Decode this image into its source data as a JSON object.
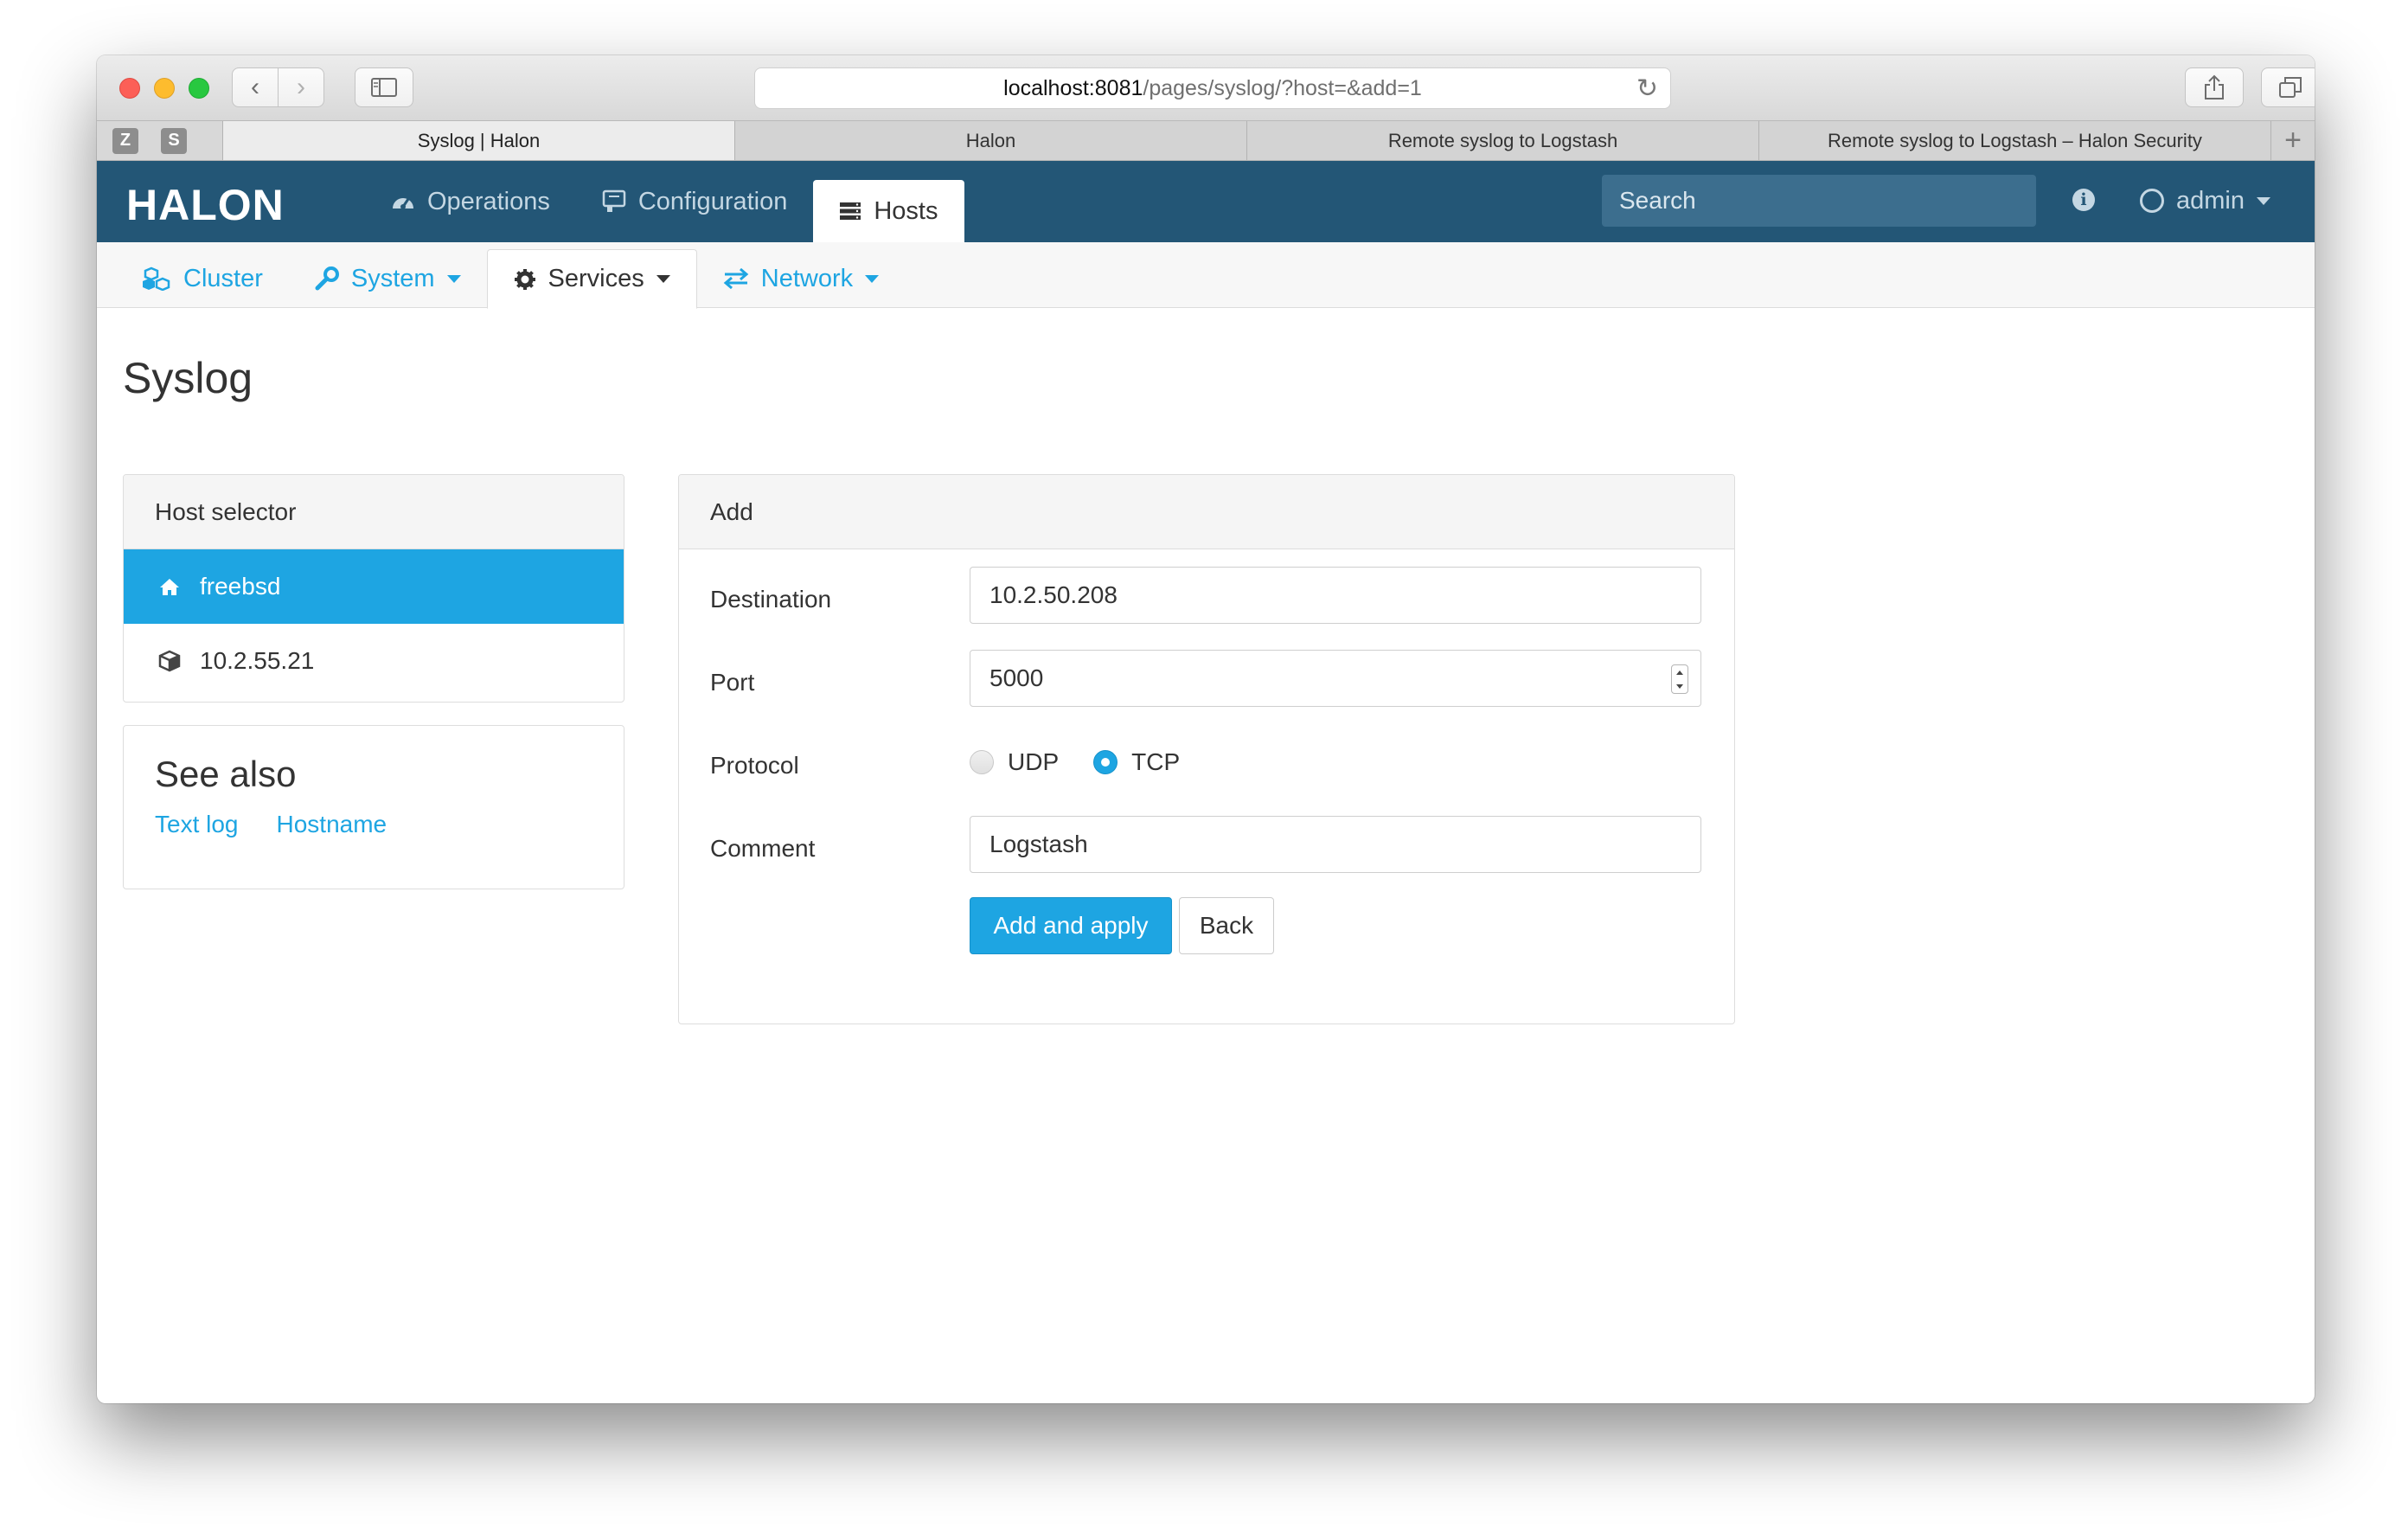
{
  "browser": {
    "url_host": "localhost:8081",
    "url_path": "/pages/syslog/?host=&add=1",
    "pinned_tabs": [
      "Z",
      "S"
    ],
    "tabs": [
      {
        "label": "Syslog | Halon"
      },
      {
        "label": "Halon"
      },
      {
        "label": "Remote syslog to Logstash"
      },
      {
        "label": "Remote syslog to Logstash – Halon Security"
      }
    ],
    "new_tab_glyph": "+"
  },
  "app": {
    "logo": "HALON",
    "brand_color": "#235676",
    "accent_color": "#1ea5e2",
    "nav": [
      {
        "label": "Operations",
        "icon": "dashboard-icon"
      },
      {
        "label": "Configuration",
        "icon": "config-icon"
      },
      {
        "label": "Hosts",
        "icon": "server-icon"
      }
    ],
    "search_placeholder": "Search",
    "user": "admin"
  },
  "subnav": [
    {
      "label": "Cluster",
      "icon": "cubes-icon"
    },
    {
      "label": "System",
      "icon": "wrench-icon"
    },
    {
      "label": "Services",
      "icon": "gear-icon"
    },
    {
      "label": "Network",
      "icon": "exchange-icon"
    }
  ],
  "page": {
    "title": "Syslog"
  },
  "host_selector": {
    "heading": "Host selector",
    "hosts": [
      {
        "label": "freebsd",
        "icon": "home-icon"
      },
      {
        "label": "10.2.55.21",
        "icon": "cube-icon"
      }
    ]
  },
  "see_also": {
    "title": "See also",
    "links": [
      "Text log",
      "Hostname"
    ]
  },
  "add_form": {
    "heading": "Add",
    "destination_label": "Destination",
    "destination_value": "10.2.50.208",
    "port_label": "Port",
    "port_value": "5000",
    "protocol_label": "Protocol",
    "protocol_options": [
      "UDP",
      "TCP"
    ],
    "protocol_selected": "TCP",
    "comment_label": "Comment",
    "comment_value": "Logstash",
    "submit_label": "Add and apply",
    "back_label": "Back"
  }
}
